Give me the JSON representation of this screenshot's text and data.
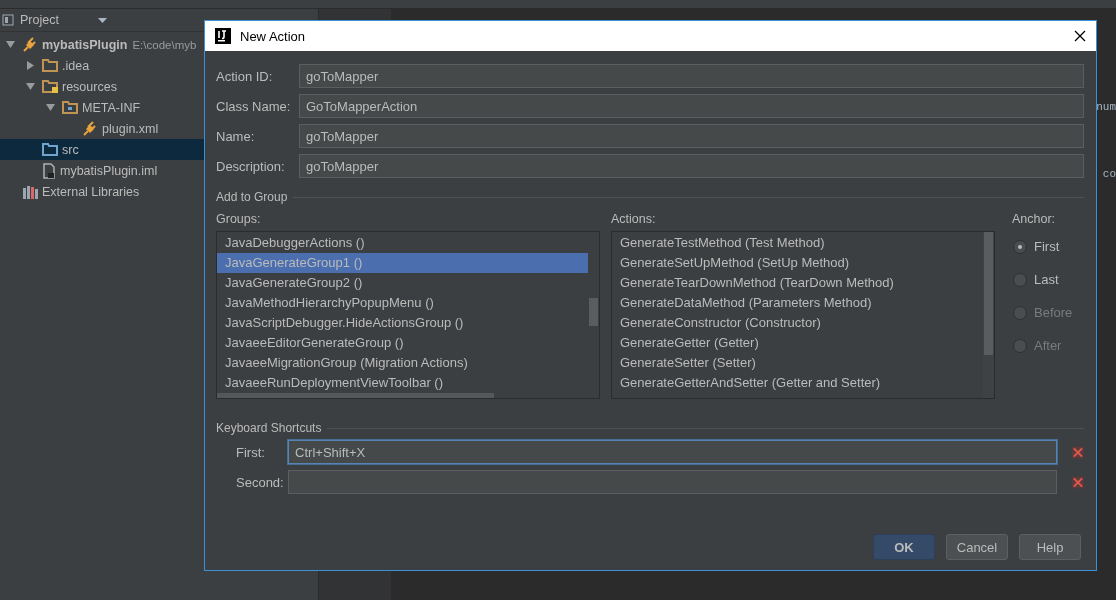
{
  "project_panel": {
    "title": "Project",
    "tree": [
      {
        "label": "mybatisPlugin",
        "path": "E:\\code\\myb",
        "kind": "module",
        "expanded": true,
        "selected": false,
        "children": [
          {
            "label": ".idea",
            "kind": "folder",
            "expanded": false,
            "selected": false
          },
          {
            "label": "resources",
            "kind": "resources-folder",
            "expanded": true,
            "selected": false,
            "children": [
              {
                "label": "META-INF",
                "kind": "meta-folder",
                "expanded": true,
                "selected": false,
                "children": [
                  {
                    "label": "plugin.xml",
                    "kind": "plugin-file",
                    "selected": false
                  }
                ]
              }
            ]
          },
          {
            "label": "src",
            "kind": "source-folder",
            "selected": true
          },
          {
            "label": "mybatisPlugin.iml",
            "kind": "iml-file",
            "selected": false
          }
        ]
      },
      {
        "label": "External Libraries",
        "kind": "libraries",
        "selected": false
      }
    ]
  },
  "editor": {
    "fragments": [
      "num",
      "co"
    ]
  },
  "dialog": {
    "title": "New Action",
    "fields": [
      {
        "label": "Action ID:",
        "value": "goToMapper"
      },
      {
        "label": "Class Name:",
        "value": "GoToMapperAction"
      },
      {
        "label": "Name:",
        "value": "goToMapper"
      },
      {
        "label": "Description:",
        "value": "goToMapper"
      }
    ],
    "group_section": "Add to Group",
    "groups": {
      "label": "Groups:",
      "items": [
        {
          "text": "JavaDebuggerActions ()",
          "selected": false
        },
        {
          "text": "JavaGenerateGroup1 ()",
          "selected": true
        },
        {
          "text": "JavaGenerateGroup2 ()",
          "selected": false
        },
        {
          "text": "JavaMethodHierarchyPopupMenu ()",
          "selected": false
        },
        {
          "text": "JavaScriptDebugger.HideActionsGroup ()",
          "selected": false
        },
        {
          "text": "JavaeeEditorGenerateGroup ()",
          "selected": false
        },
        {
          "text": "JavaeeMigrationGroup (Migration Actions)",
          "selected": false
        },
        {
          "text": "JavaeeRunDeploymentViewToolbar ()",
          "selected": false
        }
      ]
    },
    "actions": {
      "label": "Actions:",
      "items": [
        {
          "text": "GenerateTestMethod (Test Method)",
          "selected": false
        },
        {
          "text": "GenerateSetUpMethod (SetUp Method)",
          "selected": false
        },
        {
          "text": "GenerateTearDownMethod (TearDown Method)",
          "selected": false
        },
        {
          "text": "GenerateDataMethod (Parameters Method)",
          "selected": false
        },
        {
          "text": "GenerateConstructor (Constructor)",
          "selected": false
        },
        {
          "text": "GenerateGetter (Getter)",
          "selected": false
        },
        {
          "text": "GenerateSetter (Setter)",
          "selected": false
        },
        {
          "text": "GenerateGetterAndSetter (Getter and Setter)",
          "selected": false
        }
      ]
    },
    "anchor": {
      "label": "Anchor:",
      "options": [
        {
          "label": "First",
          "selected": true,
          "disabled": false
        },
        {
          "label": "Last",
          "selected": false,
          "disabled": false
        },
        {
          "label": "Before",
          "selected": false,
          "disabled": true
        },
        {
          "label": "After",
          "selected": false,
          "disabled": true
        }
      ]
    },
    "shortcut_section": "Keyboard Shortcuts",
    "shortcuts": [
      {
        "label": "First:",
        "value": "Ctrl+Shift+X",
        "focused": true
      },
      {
        "label": "Second:",
        "focused": false
      }
    ],
    "buttons": [
      {
        "label": "OK",
        "kind": "primary"
      },
      {
        "label": "Cancel",
        "kind": "normal"
      },
      {
        "label": "Help",
        "kind": "normal"
      }
    ]
  }
}
